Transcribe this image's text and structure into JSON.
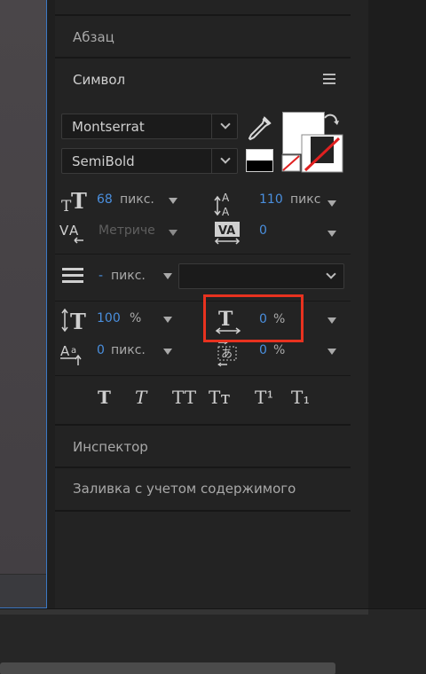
{
  "sections": {
    "paragraph": "Абзац",
    "character": "Символ",
    "inspector": "Инспектор",
    "content_fill": "Заливка с учетом содержимого"
  },
  "font": {
    "family": "Montserrat",
    "style": "SemiBold"
  },
  "character": {
    "font_size_value": "68",
    "font_size_unit": "пикс.",
    "leading_value": "110",
    "leading_unit": "пикс",
    "kerning": "Метриче",
    "tracking": "0",
    "indent_value": "-",
    "indent_unit": "пикс.",
    "vertical_scale_value": "100",
    "vertical_scale_unit": "%",
    "horizontal_scale_value": "0",
    "horizontal_scale_unit": "%",
    "baseline_shift_value": "0",
    "baseline_shift_unit": "пикс.",
    "tsume_value": "0",
    "tsume_unit": "%"
  },
  "format_buttons": [
    "T",
    "T",
    "TT",
    "Tт",
    "T¹",
    "T₁"
  ],
  "colors": {
    "fill": "#ffffff",
    "stroke": "#ffffff",
    "accent_blue": "#4a8fde",
    "highlight": "#e8321f"
  }
}
